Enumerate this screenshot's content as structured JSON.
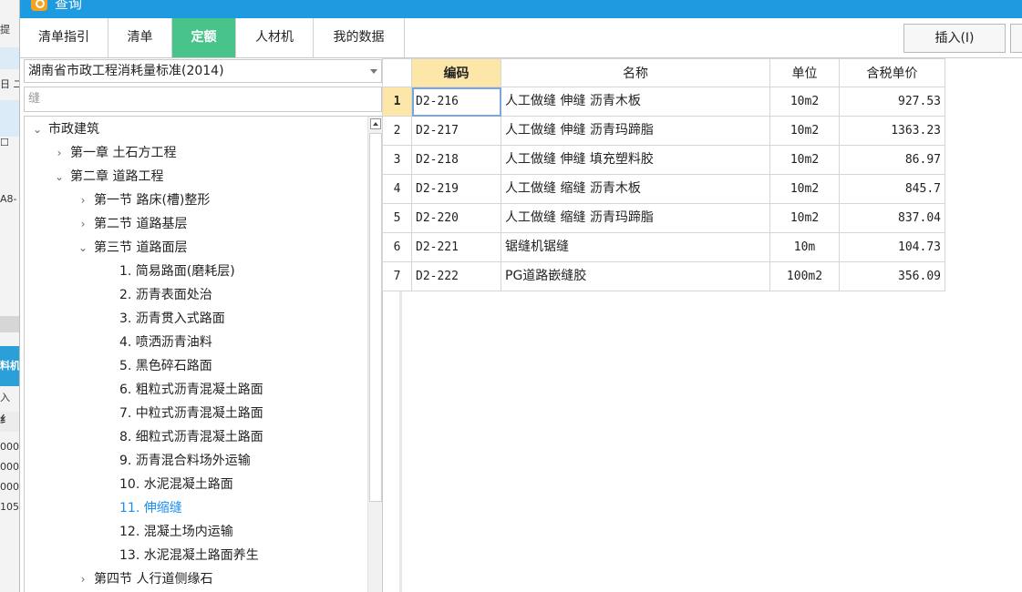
{
  "background_app": {
    "fragments": [
      "提",
      "日 二",
      "☐",
      "A8-",
      "料机",
      "入",
      "纟",
      "000",
      "000",
      "000",
      "105"
    ]
  },
  "dialog": {
    "title": "查询",
    "tabs": [
      {
        "label": "清单指引"
      },
      {
        "label": "清单"
      },
      {
        "label": "定额"
      },
      {
        "label": "人材机"
      },
      {
        "label": "我的数据"
      }
    ],
    "insert_button": "插入(I)"
  },
  "left": {
    "standard_select": "湖南省市政工程消耗量标准(2014)",
    "search_value": "缝",
    "tree": [
      {
        "label": "市政建筑",
        "chevron": "down"
      },
      {
        "label": "第一章 土石方工程",
        "chevron": "right"
      },
      {
        "label": "第二章 道路工程",
        "chevron": "down"
      },
      {
        "label": "第一节 路床(槽)整形",
        "chevron": "right"
      },
      {
        "label": "第二节 道路基层",
        "chevron": "right"
      },
      {
        "label": "第三节 道路面层",
        "chevron": "down"
      },
      {
        "label": "1.  简易路面(磨耗层)"
      },
      {
        "label": "2.  沥青表面处治"
      },
      {
        "label": "3.  沥青贯入式路面"
      },
      {
        "label": "4.  喷洒沥青油料"
      },
      {
        "label": "5.  黑色碎石路面"
      },
      {
        "label": "6.  粗粒式沥青混凝土路面"
      },
      {
        "label": "7.  中粒式沥青混凝土路面"
      },
      {
        "label": "8.  细粒式沥青混凝土路面"
      },
      {
        "label": "9.  沥青混合料场外运输"
      },
      {
        "label": "10.  水泥混凝土路面"
      },
      {
        "label": "11.  伸缩缝"
      },
      {
        "label": "12.  混凝土场内运输"
      },
      {
        "label": "13.  水泥混凝土路面养生"
      },
      {
        "label": "第四节 人行道侧缘石",
        "chevron": "right"
      }
    ]
  },
  "table": {
    "headers": {
      "code": "编码",
      "name": "名称",
      "unit": "单位",
      "price": "含税单价"
    },
    "rows": [
      {
        "num": "1",
        "code": "D2-216",
        "name": "人工做缝 伸缝 沥青木板",
        "unit": "10m2",
        "price": "927.53"
      },
      {
        "num": "2",
        "code": "D2-217",
        "name": "人工做缝 伸缝 沥青玛蹄脂",
        "unit": "10m2",
        "price": "1363.23"
      },
      {
        "num": "3",
        "code": "D2-218",
        "name": "人工做缝 伸缝 填充塑料胶",
        "unit": "10m2",
        "price": "86.97"
      },
      {
        "num": "4",
        "code": "D2-219",
        "name": "人工做缝 缩缝 沥青木板",
        "unit": "10m2",
        "price": "845.7"
      },
      {
        "num": "5",
        "code": "D2-220",
        "name": "人工做缝 缩缝 沥青玛蹄脂",
        "unit": "10m2",
        "price": "837.04"
      },
      {
        "num": "6",
        "code": "D2-221",
        "name": "锯缝机锯缝",
        "unit": "10m",
        "price": "104.73"
      },
      {
        "num": "7",
        "code": "D2-222",
        "name": "PG道路嵌缝胶",
        "unit": "100m2",
        "price": "356.09"
      }
    ]
  },
  "colors": {
    "title_bar": "#1e9be0",
    "active_tab": "#48c38a",
    "header_highlight": "#fce6a8",
    "selected_tree": "#1c8ef2"
  }
}
